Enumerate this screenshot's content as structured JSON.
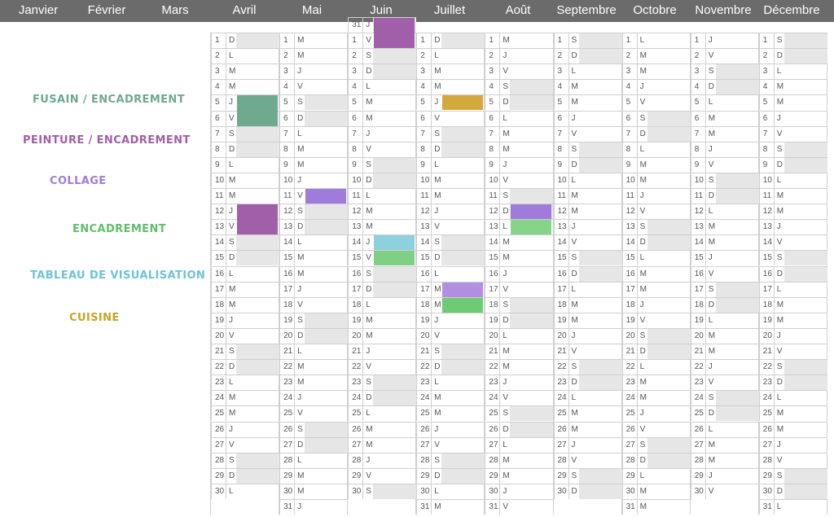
{
  "months": [
    {
      "name": "Janvier",
      "first_weekday": 0,
      "days": 31
    },
    {
      "name": "Février",
      "first_weekday": 3,
      "days": 28
    },
    {
      "name": "Mars",
      "first_weekday": 3,
      "days": 31
    },
    {
      "name": "Avril",
      "first_weekday": 6,
      "days": 30
    },
    {
      "name": "Mai",
      "first_weekday": 1,
      "days": 31
    },
    {
      "name": "Juin",
      "first_weekday": 4,
      "days": 30
    },
    {
      "name": "Juillet",
      "first_weekday": 6,
      "days": 31
    },
    {
      "name": "Août",
      "first_weekday": 2,
      "days": 31
    },
    {
      "name": "Septembre",
      "first_weekday": 5,
      "days": 30
    },
    {
      "name": "Octobre",
      "first_weekday": 0,
      "days": 31
    },
    {
      "name": "Novembre",
      "first_weekday": 3,
      "days": 30
    },
    {
      "name": "Décembre",
      "first_weekday": 5,
      "days": 31
    }
  ],
  "weekday_letters": [
    "L",
    "M",
    "M",
    "J",
    "V",
    "S",
    "D"
  ],
  "legend": [
    {
      "label": "FUSAIN / ENCADREMENT",
      "color": "#6fa98e"
    },
    {
      "label": "PEINTURE / ENCADREMENT",
      "color": "#a05fa8"
    },
    {
      "label": "COLLAGE",
      "color": "#a07bdc"
    },
    {
      "label": "ENCADREMENT",
      "color": "#5fbf6c"
    },
    {
      "label": "TABLEAU DE VISUALISATION",
      "color": "#6cc3d8"
    },
    {
      "label": "CUISINE",
      "color": "#c9a227"
    }
  ],
  "events": [
    {
      "type": "FUSAIN / ENCADREMENT",
      "month": "Avril",
      "from": 5,
      "to": 6,
      "color": "#6fa98e"
    },
    {
      "type": "PEINTURE / ENCADREMENT",
      "month": "Avril",
      "from": 12,
      "to": 13,
      "color": "#a05fa8"
    },
    {
      "type": "PEINTURE / ENCADREMENT",
      "month": "Juin",
      "from": 31,
      "to": 1,
      "color": "#a05fa8"
    },
    {
      "type": "COLLAGE",
      "month": "Mai",
      "from": 11,
      "to": 11,
      "color": "#a07bdc"
    },
    {
      "type": "COLLAGE",
      "month": "Juillet",
      "from": 17,
      "to": 17,
      "color": "#b28ee3"
    },
    {
      "type": "COLLAGE",
      "month": "Août",
      "from": 12,
      "to": 12,
      "color": "#a07bdc"
    },
    {
      "type": "ENCADREMENT",
      "month": "Juin",
      "from": 15,
      "to": 15,
      "color": "#7fcf84"
    },
    {
      "type": "ENCADREMENT",
      "month": "Juillet",
      "from": 18,
      "to": 18,
      "color": "#6ecb73"
    },
    {
      "type": "ENCADREMENT",
      "month": "Août",
      "from": 13,
      "to": 13,
      "color": "#86d488"
    },
    {
      "type": "TABLEAU DE VISUALISATION",
      "month": "Juin",
      "from": 14,
      "to": 14,
      "color": "#8ed0de"
    },
    {
      "type": "CUISINE",
      "month": "Juillet",
      "from": 5,
      "to": 5,
      "color": "#d4a93c"
    }
  ],
  "colors": {
    "header_bg": "#6b6b6b",
    "weekend_block": "#e6e6e6",
    "grid": "#cfcfcf"
  }
}
